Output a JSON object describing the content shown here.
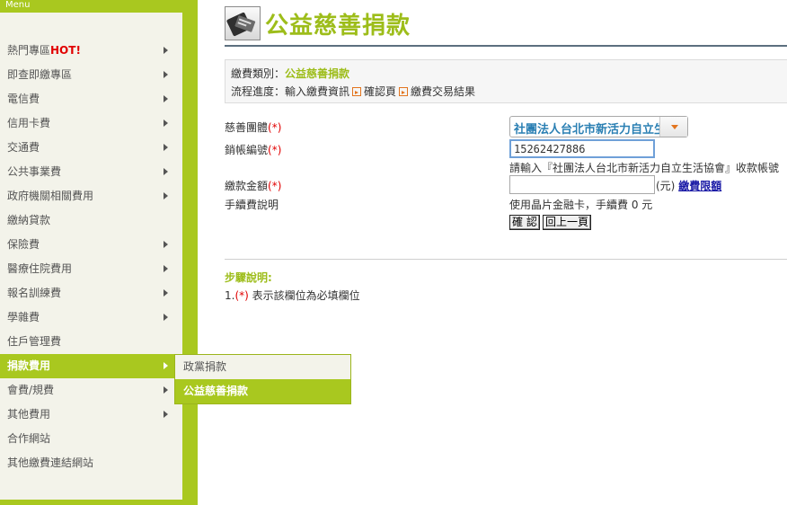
{
  "sidebar": {
    "menu_label": "Menu",
    "items": [
      {
        "label": "熱門專區",
        "hot": "HOT!",
        "arrow": true
      },
      {
        "label": "即查即繳專區",
        "arrow": true
      },
      {
        "label": "電信費",
        "arrow": true
      },
      {
        "label": "信用卡費",
        "arrow": true
      },
      {
        "label": "交通費",
        "arrow": true
      },
      {
        "label": "公共事業費",
        "arrow": true
      },
      {
        "label": "政府機關相關費用",
        "arrow": true
      },
      {
        "label": "繳納貸款",
        "arrow": false
      },
      {
        "label": "保險費",
        "arrow": true
      },
      {
        "label": "醫療住院費用",
        "arrow": true
      },
      {
        "label": "報名訓練費",
        "arrow": true
      },
      {
        "label": "學雜費",
        "arrow": true
      },
      {
        "label": "住戶管理費",
        "arrow": false
      },
      {
        "label": "捐款費用",
        "arrow": true,
        "active": true
      },
      {
        "label": "會費/規費",
        "arrow": true
      },
      {
        "label": "其他費用",
        "arrow": true
      },
      {
        "label": "合作網站",
        "arrow": false
      },
      {
        "label": "其他繳費連結網站",
        "arrow": false
      }
    ],
    "submenu": [
      {
        "label": "政黨捐款"
      },
      {
        "label": "公益慈善捐款",
        "active": true
      }
    ]
  },
  "page": {
    "title": "公益慈善捐款",
    "icon": "payment-card-icon"
  },
  "info": {
    "category_label": "繳費類別：",
    "category_value": "公益慈善捐款",
    "progress_label": "流程進度：",
    "step1": "輸入繳費資訊",
    "step2": "確認頁",
    "step3": "繳費交易結果"
  },
  "form": {
    "org_label": "慈善團體",
    "org_req": "(*)",
    "org_value": "社團法人台北市新活力自立生活協會",
    "account_label": "銷帳編號",
    "account_req": "(*)",
    "account_value": "15262427886",
    "account_hint": "請輸入『社團法人台北市新活力自立生活協會』收款帳號",
    "amount_label": "繳款金額",
    "amount_req": "(*)",
    "amount_value": "",
    "amount_unit": "(元)",
    "amount_limit_link": "繳費限額",
    "fee_label": "手續費說明",
    "fee_text": "使用晶片金融卡，手續費 0 元",
    "confirm_button": "確 認",
    "back_button": "回上一頁"
  },
  "steps": {
    "title": "步驟說明:",
    "line_num": "1.",
    "line_req": "(*)",
    "line_text": " 表示該欄位為必填欄位"
  },
  "colors": {
    "accent_green": "#a9c81f",
    "title_green": "#9dbd1a",
    "required_red": "#e10000",
    "select_text_blue": "#2a7fb3"
  }
}
